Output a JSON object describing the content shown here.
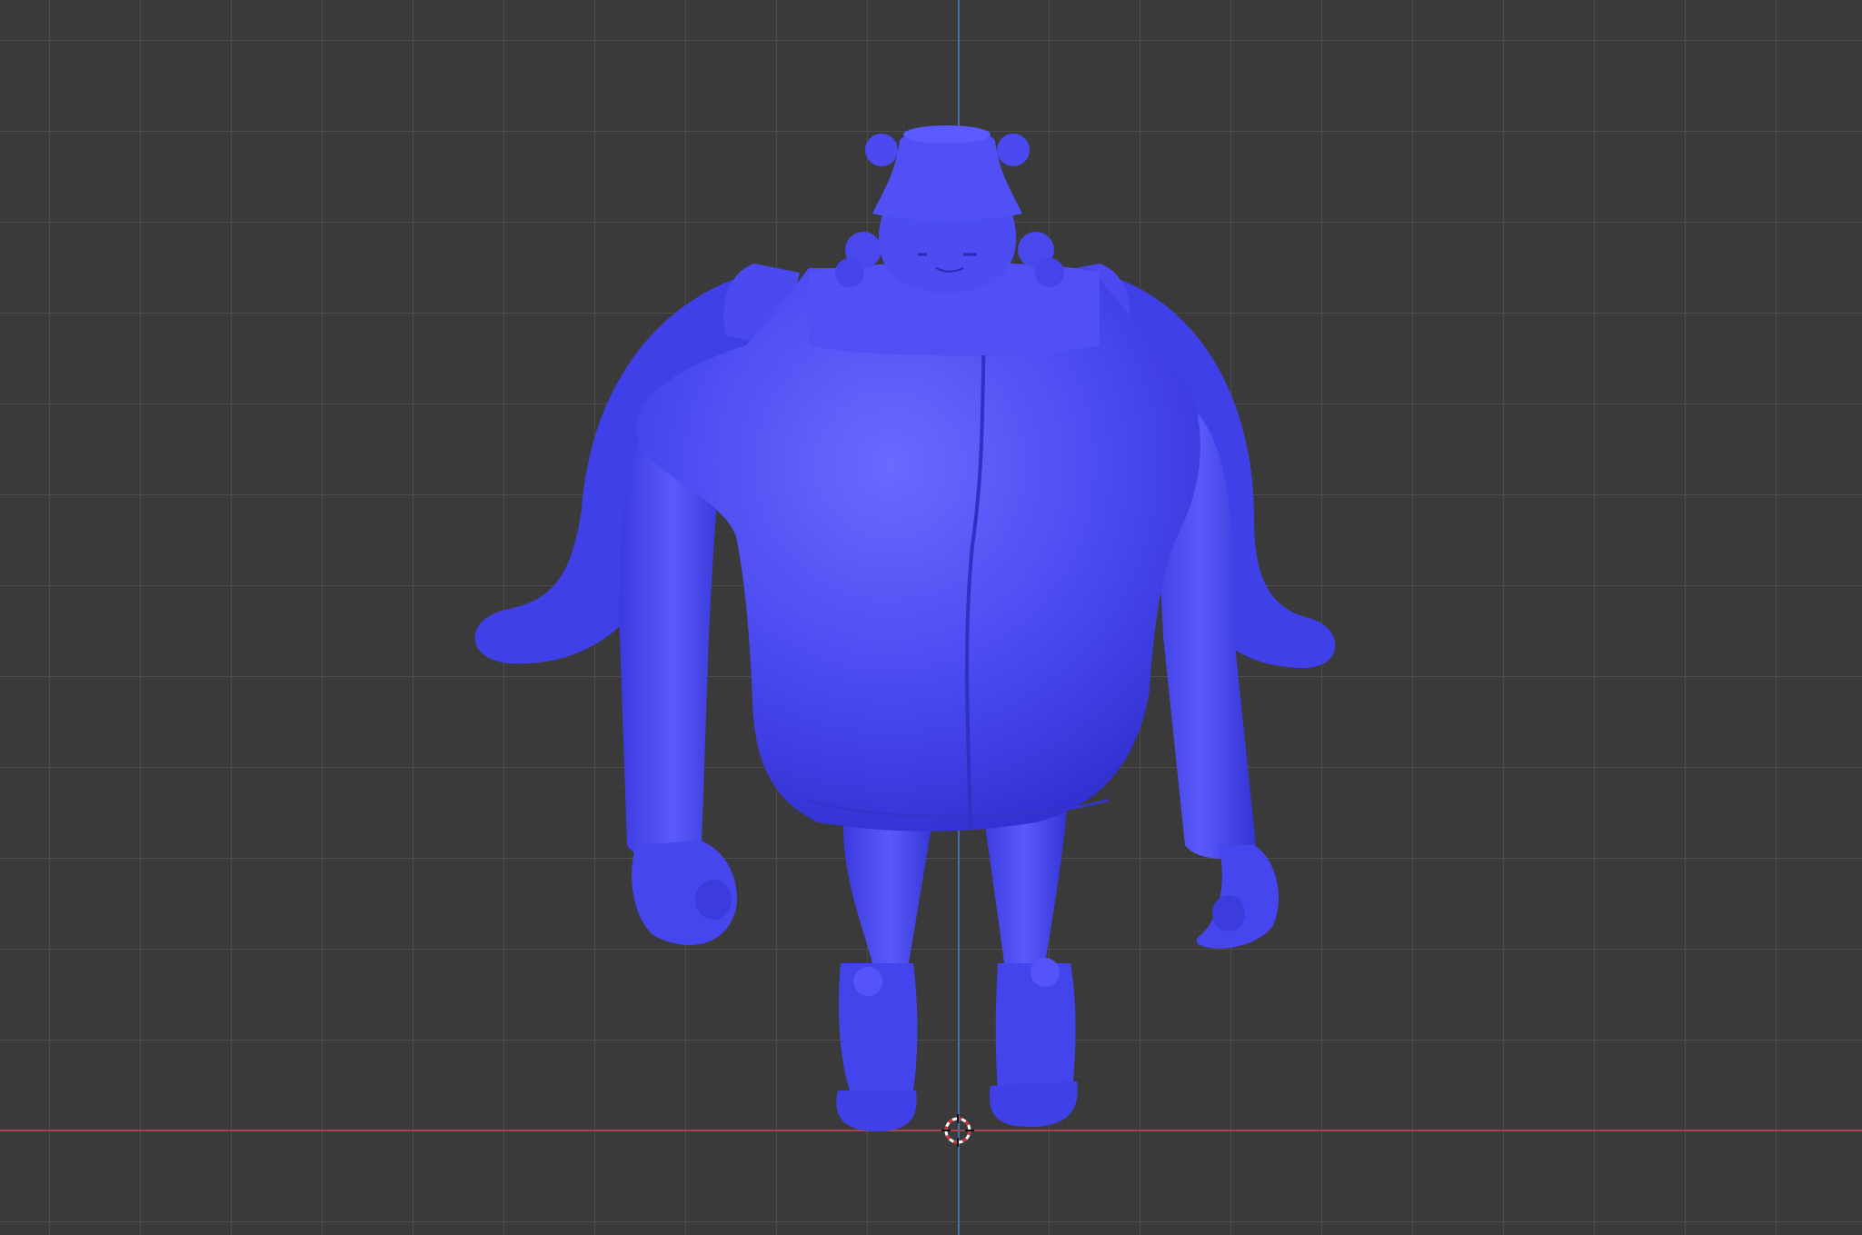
{
  "viewport": {
    "view": "front-orthographic",
    "background_color": "#3a3a3a",
    "grid_major_color": "#4e4e4e",
    "grid_minor_color": "#3e3e3e",
    "axis_x_color": "#a8464c",
    "axis_z_color": "#4a6fa8"
  },
  "model": {
    "type": "character-mesh",
    "shading": "solid",
    "color": "#4444ee",
    "highlight_color": "#6a6aff",
    "shadow_color": "#2c2cc8"
  },
  "cursor": {
    "icon": "3d-cursor-icon",
    "ring_color": "#ffffff",
    "dash_color": "#d03030"
  }
}
